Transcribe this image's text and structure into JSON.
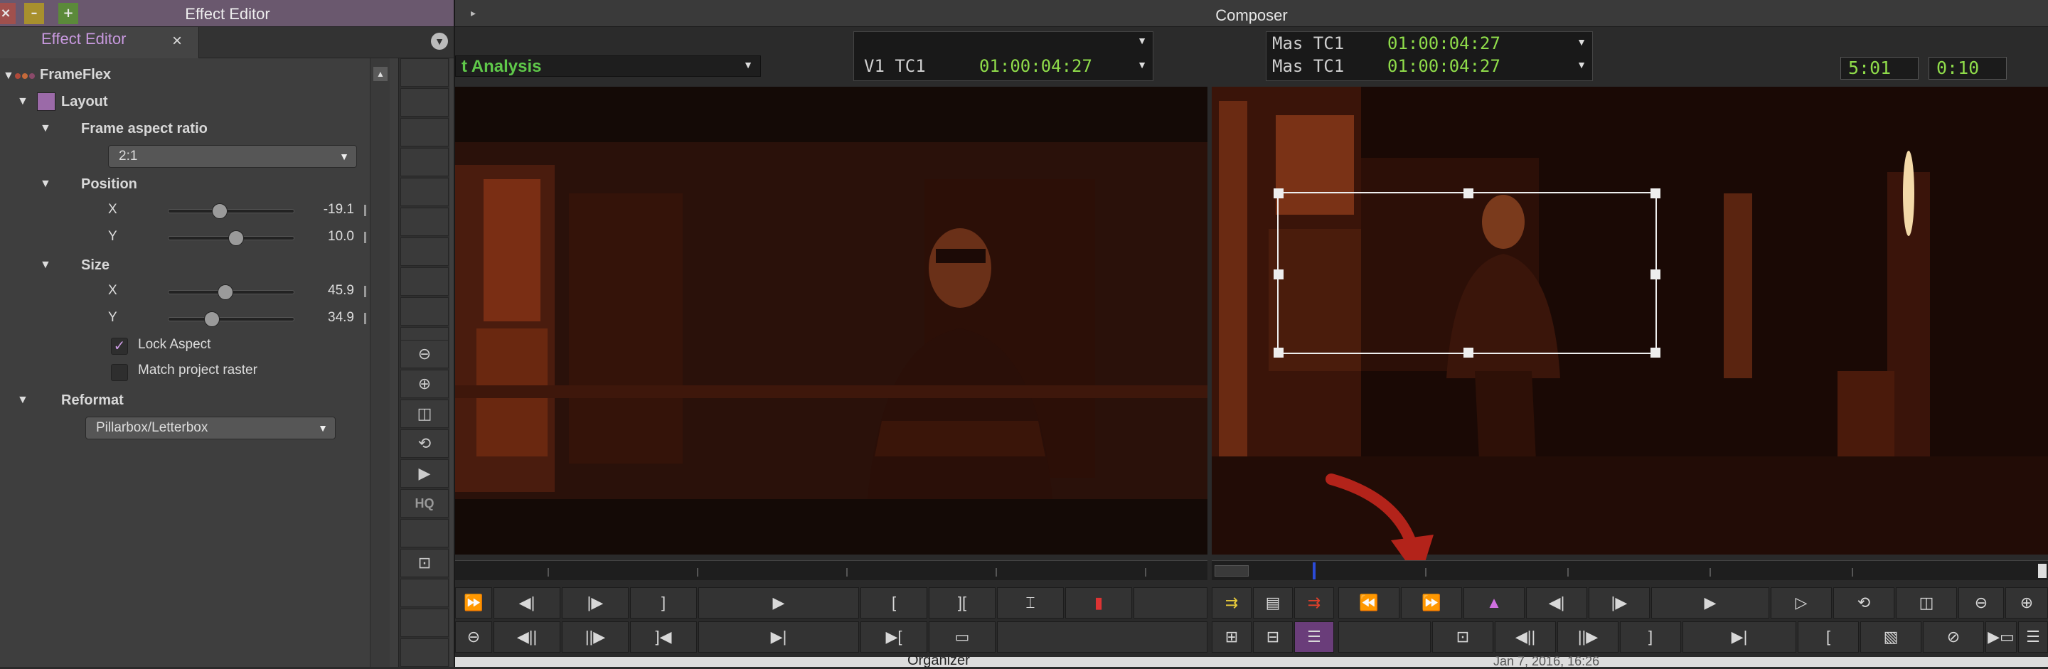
{
  "effect_editor": {
    "window_title": "Effect Editor",
    "tab_label": "Effect Editor",
    "close_glyph": "×",
    "effect_name": "FrameFlex",
    "layout_label": "Layout",
    "frame_aspect_label": "Frame aspect ratio",
    "frame_aspect_value": "2:1",
    "position_label": "Position",
    "position_x_label": "X",
    "position_x_value": "-19.1",
    "position_y_label": "Y",
    "position_y_value": "10.0",
    "size_label": "Size",
    "size_x_label": "X",
    "size_x_value": "45.9",
    "size_y_label": "Y",
    "size_y_value": "34.9",
    "lock_aspect_label": "Lock Aspect",
    "lock_aspect_checked": true,
    "match_raster_label": "Match project raster",
    "match_raster_checked": false,
    "reformat_label": "Reformat",
    "reformat_value": "Pillarbox/Letterbox",
    "tool_hq_label": "HQ"
  },
  "composer": {
    "window_title": "Composer",
    "clip_name": "t Analysis",
    "tc_top_left_label": "V1 TC1",
    "tc_top_left_value": "01:00:04:27",
    "tc_right_1_label": "Mas TC1",
    "tc_right_1_value": "01:00:04:27",
    "tc_right_2_label": "Mas TC1",
    "tc_right_2_value": "01:00:04:27",
    "duration_1": "5:01",
    "duration_2": "0:10"
  },
  "bottom_bar": {
    "organizer_label": "Organizer",
    "date_text": "Jan 7, 2016, 16:26"
  },
  "colors": {
    "timecode_green": "#8fdc4a",
    "clip_name_green": "#5fc84a",
    "accent_purple": "#c99ae0",
    "annotation_arrow_red": "#b3231a"
  }
}
